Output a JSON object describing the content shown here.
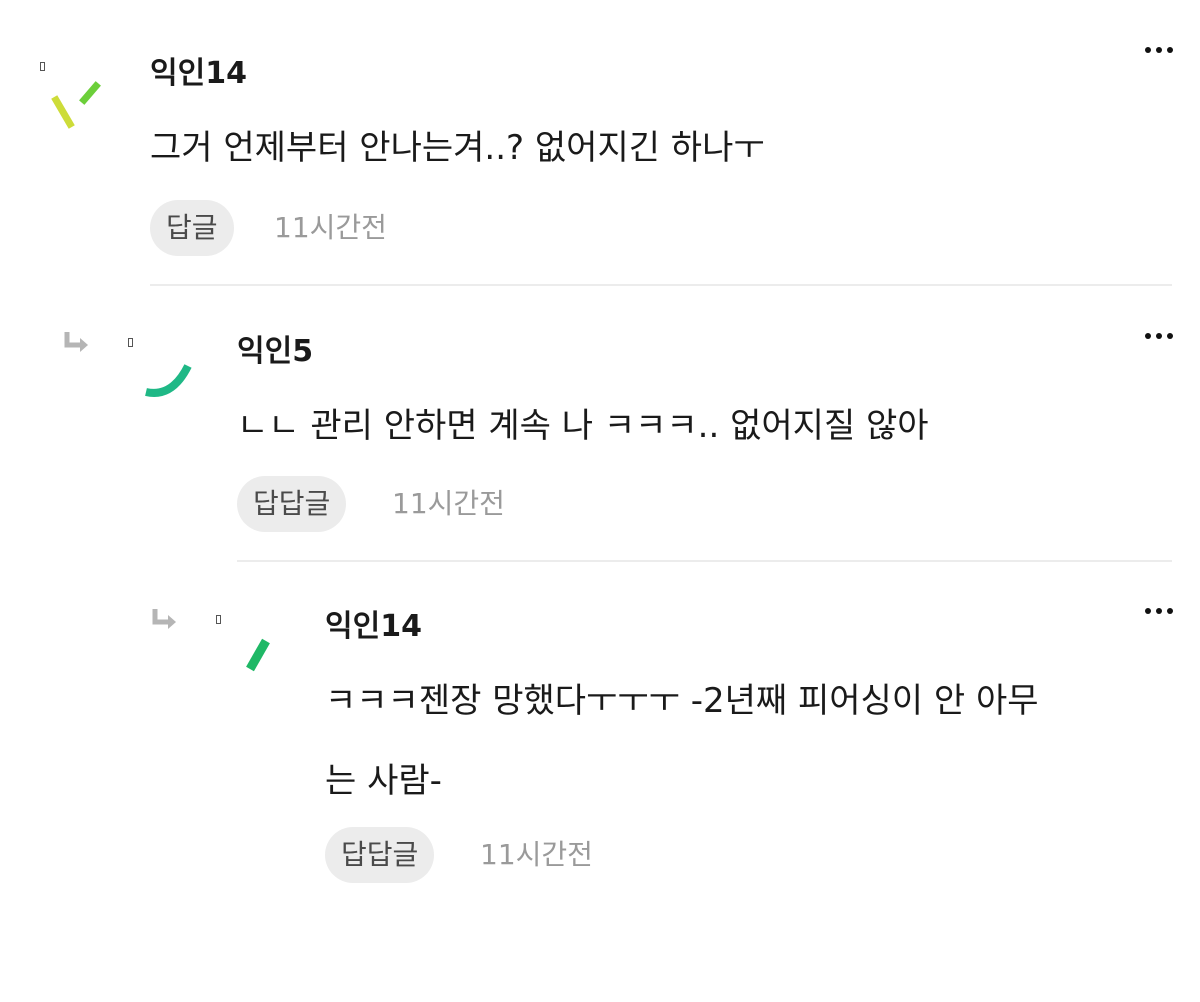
{
  "comments": [
    {
      "nickname": "익인14",
      "text": "그거 언제부터 안나는겨..? 없어지긴 하나ㅜ",
      "reply_label": "답글",
      "time": "11시간전"
    },
    {
      "nickname": "익인5",
      "text": "ㄴㄴ 관리 안하면 계속 나 ㅋㅋㅋ.. 없어지질 않아",
      "reply_label": "답답글",
      "time": "11시간전"
    },
    {
      "nickname": "익인14",
      "text_line1": "ㅋㅋㅋ젠장 망했다ㅜㅜㅜ -2년째 피어싱이 안 아무",
      "text_line2": "는 사람-",
      "reply_label": "답답글",
      "time": "11시간전"
    }
  ],
  "icons": {
    "more": "more-options-icon",
    "reply_arrow": "reply-arrow-icon",
    "avatar": "avatar"
  },
  "colors": {
    "text": "#1a1a1a",
    "meta": "#9a9a9a",
    "pill": "#ececec",
    "avatar_lime": "#cddc39",
    "avatar_green": "#6ccf3a",
    "avatar_teal": "#1fb886",
    "avatar_emerald": "#1fb866"
  }
}
